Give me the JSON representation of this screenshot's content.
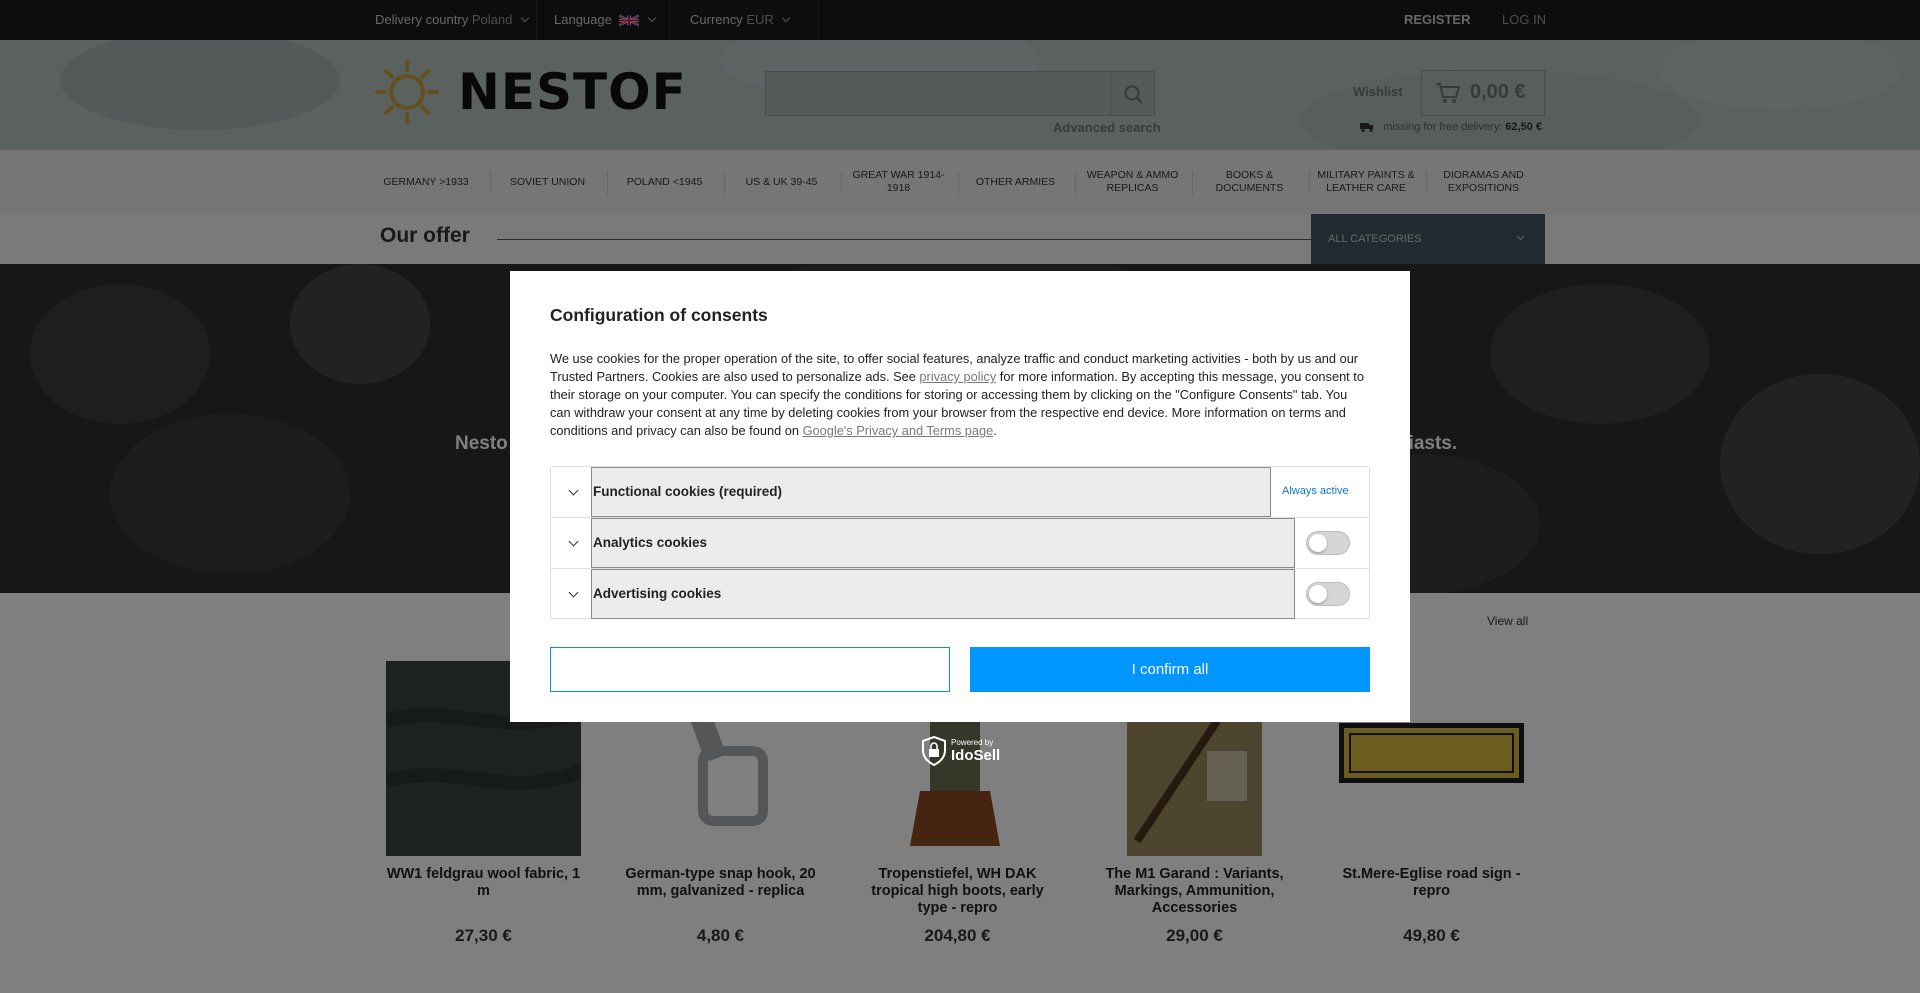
{
  "topbar": {
    "delivery_label": "Delivery country",
    "delivery_value": "Poland",
    "language_label": "Language",
    "currency_label": "Currency",
    "currency_value": "EUR",
    "register": "REGISTER",
    "login": "LOG IN"
  },
  "header": {
    "logo_text": "NESTOF",
    "search_placeholder": "",
    "advanced_search": "Advanced search",
    "wishlist": "Wishlist",
    "cart_amount": "0,00 €",
    "free_delivery_label": "missing for free delivery:",
    "free_delivery_value": "62,50 €"
  },
  "nav": {
    "items": [
      "GERMANY >1933",
      "SOVIET UNION",
      "POLAND <1945",
      "US & UK 39-45",
      "GREAT WAR 1914-1918",
      "OTHER ARMIES",
      "WEAPON & AMMO REPLICAS",
      "BOOKS & DOCUMENTS",
      "MILITARY PAINTS & LEATHER CARE",
      "DIORAMAS AND EXPOSITIONS"
    ]
  },
  "offer": {
    "title": "Our offer",
    "categories_select": "ALL CATEGORIES"
  },
  "banner": {
    "text_left": "Nesto",
    "text_right": "siasts."
  },
  "products": {
    "view_all": "View all",
    "items": [
      {
        "name": "WW1 feldgrau wool fabric, 1 m",
        "price": "27,30 €"
      },
      {
        "name": "German-type snap hook, 20 mm, galvanized - replica",
        "price": "4,80 €"
      },
      {
        "name": "Tropenstiefel, WH DAK tropical high boots, early type - repro",
        "price": "204,80 €"
      },
      {
        "name": "The M1 Garand : Variants, Markings, Ammunition, Accessories",
        "price": "29,00 €"
      },
      {
        "name": "St.Mere-Eglise road sign - repro",
        "price": "49,80 €"
      }
    ]
  },
  "consent": {
    "title": "Configuration of consents",
    "text_1": "We use cookies for the proper operation of the site, to offer social features, analyze traffic and conduct marketing activities - both by us and our Trusted Partners. Cookies are also used to personalize ads. See ",
    "privacy_link": "privacy policy",
    "text_2": " for more information. By accepting this message, you consent to their storage on your computer. You can specify the conditions for storing or accessing them by clicking on the \"Configure Consents\" tab. You can withdraw your consent at any time by deleting cookies from your browser from the respective end device. More information on terms and conditions and privacy can also be found on ",
    "google_link": "Google's Privacy and Terms page",
    "text_3": ".",
    "rows": [
      {
        "label": "Functional cookies (required)",
        "status": "Always active"
      },
      {
        "label": "Analytics cookies",
        "enabled": false
      },
      {
        "label": "Advertising cookies",
        "enabled": false
      }
    ],
    "outline_button": "",
    "confirm_button": "I confirm all"
  },
  "idosell": {
    "small": "Powered by",
    "big": "IdoSell"
  },
  "colors": {
    "accent": "#0095ff",
    "topbar": "#1a1a1a",
    "header": "#b5c2bf",
    "category_select": "#3e5660"
  }
}
